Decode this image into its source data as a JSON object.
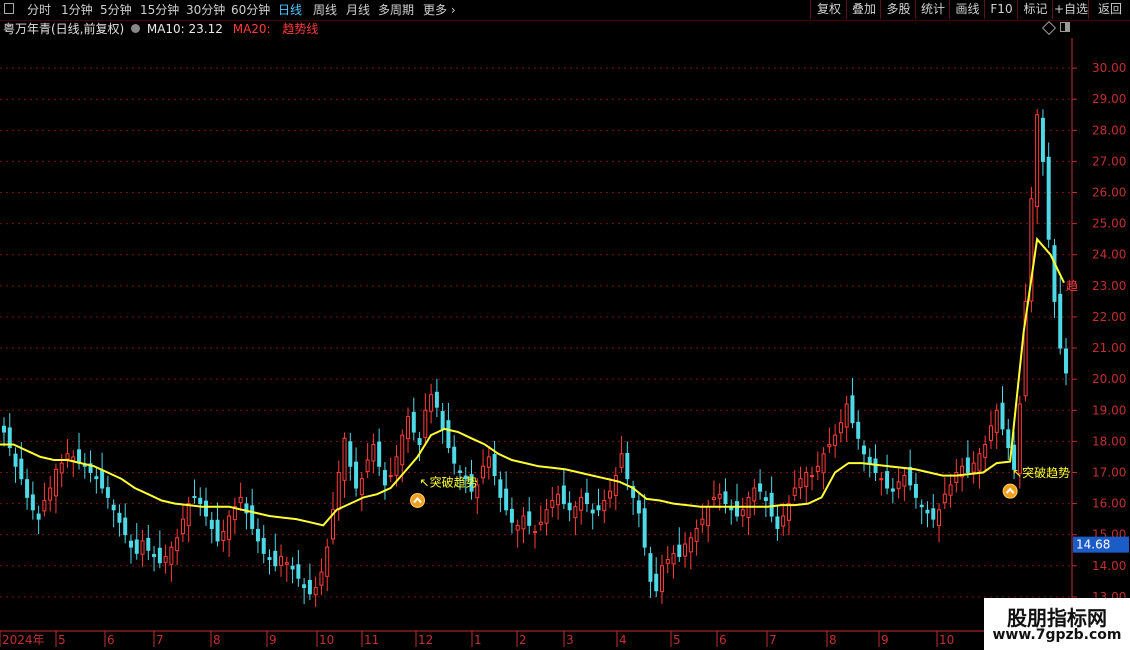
{
  "toolbar": {
    "periods": [
      "分时",
      "1分钟",
      "5分钟",
      "15分钟",
      "30分钟",
      "60分钟",
      "日线",
      "周线",
      "月线",
      "多周期",
      "更多"
    ],
    "active_period": "日线",
    "right_buttons": [
      "复权",
      "叠加",
      "多股",
      "统计",
      "画线",
      "F10",
      "标记",
      "+自选",
      "返回"
    ]
  },
  "infobar": {
    "stock": "粤万年青(日线,前复权)",
    "ma10_label": "MA10: 23.12",
    "ma20_label": "MA20:",
    "trend_label": "趋势线"
  },
  "colors": {
    "up": "#ff3c3c",
    "down": "#4fd9e6",
    "trend": "#ffff33",
    "axis": "#c03030",
    "grid": "#7a1010",
    "price_tag": "#1c5cc6"
  },
  "chart_data": {
    "type": "candlestick",
    "ylim": [
      12,
      31
    ],
    "y_ticks": [
      "13.00",
      "14.00",
      "15.00",
      "16.00",
      "17.00",
      "18.00",
      "19.00",
      "20.00",
      "21.00",
      "22.00",
      "23.00",
      "24.00",
      "25.00",
      "26.00",
      "27.00",
      "28.00",
      "29.00",
      "30.00"
    ],
    "x_ticks": [
      "2024年",
      "5",
      "6",
      "7",
      "8",
      "9",
      "10",
      "11",
      "12",
      "1",
      "2",
      "3",
      "4",
      "5",
      "6",
      "7",
      "8",
      "9",
      "10"
    ],
    "last_price": "14.68",
    "trend_line": [
      17.9,
      17.9,
      17.7,
      17.5,
      17.4,
      17.4,
      17.3,
      17.2,
      17.0,
      16.8,
      16.5,
      16.3,
      16.1,
      16.0,
      15.95,
      15.9,
      15.9,
      15.9,
      15.8,
      15.7,
      15.6,
      15.55,
      15.5,
      15.4,
      15.3,
      15.8,
      16.0,
      16.2,
      16.3,
      16.5,
      17.0,
      17.5,
      18.2,
      18.4,
      18.3,
      18.1,
      17.9,
      17.6,
      17.4,
      17.3,
      17.2,
      17.15,
      17.1,
      17.0,
      16.9,
      16.8,
      16.7,
      16.5,
      16.15,
      16.1,
      16.0,
      15.95,
      15.9,
      15.9,
      15.9,
      15.9,
      15.9,
      15.9,
      15.95,
      15.95,
      16.0,
      16.2,
      17.0,
      17.3,
      17.3,
      17.25,
      17.2,
      17.15,
      17.1,
      17.0,
      16.9,
      16.9,
      16.95,
      17.0,
      17.3,
      17.35,
      21.5,
      24.5,
      24.0,
      23.1
    ],
    "signals": [
      {
        "label": "突破趋势",
        "date_index": 31,
        "price": 16.1
      },
      {
        "label": "突破趋势",
        "date_index": 75,
        "price": 16.4
      }
    ],
    "right_edge_label": "趋",
    "candle_closes": [
      18.3,
      17.8,
      17.2,
      16.8,
      16.2,
      15.8,
      15.5,
      16.1,
      16.5,
      17.1,
      17.3,
      17.6,
      17.5,
      17.3,
      17.2,
      17.0,
      16.8,
      16.5,
      16.2,
      15.8,
      15.4,
      15.0,
      14.6,
      14.4,
      14.8,
      14.5,
      14.3,
      14.1,
      14.3,
      14.6,
      14.9,
      15.5,
      16.0,
      16.2,
      16.0,
      15.6,
      15.2,
      14.8,
      15.1,
      15.6,
      15.9,
      16.2,
      15.7,
      15.2,
      14.8,
      14.4,
      14.2,
      14.0,
      14.3,
      14.1,
      13.9,
      13.6,
      13.3,
      13.1,
      13.3,
      13.8,
      14.6,
      15.8,
      17.0,
      18.1,
      17.2,
      16.5,
      16.8,
      17.4,
      17.9,
      17.2,
      16.6,
      16.9,
      17.5,
      18.2,
      18.8,
      18.3,
      17.9,
      19.0,
      19.5,
      19.1,
      18.4,
      17.8,
      17.3,
      17.0,
      16.8,
      16.4,
      16.6,
      17.2,
      17.5,
      16.9,
      16.2,
      15.8,
      15.4,
      15.3,
      15.6,
      15.3,
      15.1,
      15.4,
      15.8,
      16.1,
      16.3,
      16.0,
      15.8,
      15.9,
      16.2,
      16.0,
      15.7,
      15.8,
      16.1,
      16.4,
      16.9,
      17.6,
      16.8,
      16.2,
      15.7,
      14.6,
      13.5,
      13.2,
      14.0,
      14.2,
      14.4,
      14.3,
      14.7,
      14.9,
      15.2,
      15.5,
      15.9,
      16.2,
      16.3,
      16.0,
      15.8,
      15.6,
      15.8,
      16.2,
      16.5,
      16.4,
      16.1,
      15.6,
      15.2,
      15.6,
      16.0,
      16.5,
      16.8,
      17.0,
      16.9,
      17.2,
      17.6,
      17.9,
      18.2,
      18.6,
      19.2,
      18.6,
      18.1,
      17.6,
      17.3,
      17.0,
      16.8,
      16.5,
      16.4,
      16.7,
      16.9,
      16.6,
      16.2,
      15.9,
      15.7,
      15.5,
      15.8,
      16.3,
      16.6,
      17.0,
      17.2,
      17.0,
      17.3,
      17.6,
      17.9,
      18.5,
      19.0,
      18.4,
      17.8,
      17.1,
      19.2,
      22.5,
      25.8,
      28.5,
      27.0,
      24.5,
      22.5,
      21.0,
      20.2
    ]
  }
}
